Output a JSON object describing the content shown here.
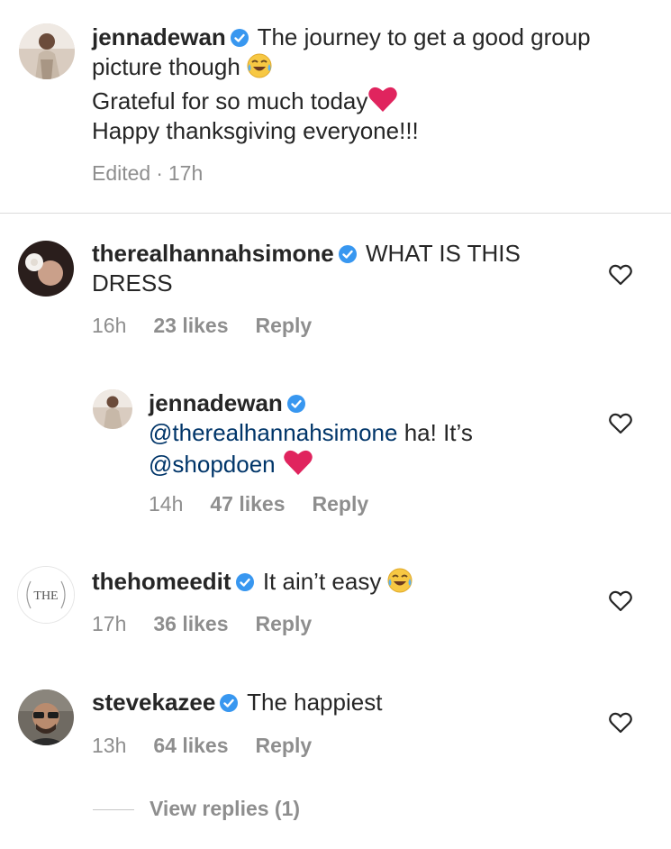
{
  "caption": {
    "username": "jennadewan",
    "text_line1": "The journey to get a good group",
    "text_line2": "picture though",
    "text_line3": "Grateful for so much today",
    "text_line4": "Happy thanksgiving everyone!!!",
    "edited": "Edited",
    "separator": "·",
    "time": "17h"
  },
  "comments": [
    {
      "username": "therealhannahsimone",
      "text_line1": "WHAT IS THIS",
      "text_line2": "DRESS",
      "time": "16h",
      "likes": "23 likes",
      "reply": "Reply"
    },
    {
      "username": "jennadewan",
      "mention": "@therealhannahsimone",
      "text_after_mention": "ha! It’s",
      "mention2": "@shopdoen",
      "time": "14h",
      "likes": "47 likes",
      "reply": "Reply"
    },
    {
      "username": "thehomeedit",
      "text_line1": "It ain’t easy",
      "avatar_logo_text": "THE",
      "time": "17h",
      "likes": "36 likes",
      "reply": "Reply"
    },
    {
      "username": "stevekazee",
      "text_line1": "The happiest",
      "time": "13h",
      "likes": "64 likes",
      "reply": "Reply",
      "view_replies": "View replies (1)"
    }
  ],
  "icons": {
    "verified": "verified-badge-icon",
    "like": "heart-outline-icon",
    "emoji_laugh": "face-with-tears-of-joy-icon",
    "emoji_heart": "red-heart-icon"
  },
  "colors": {
    "text": "#262626",
    "secondary": "#8e8e8e",
    "mention": "#003569",
    "verified": "#3897f0",
    "heart_emoji": "#e0245e"
  }
}
